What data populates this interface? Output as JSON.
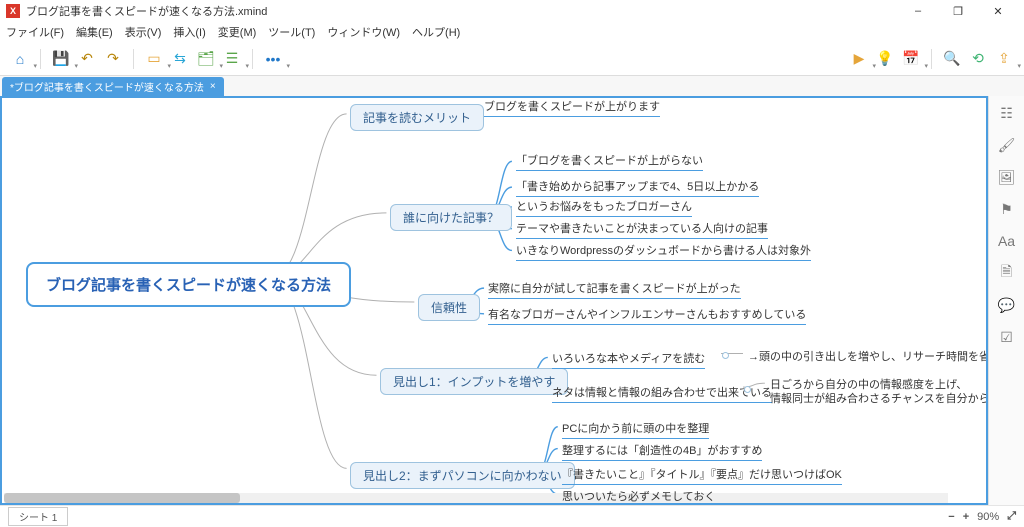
{
  "window": {
    "title": "ブログ記事を書くスピードが速くなる方法.xmind",
    "min_label": "–",
    "max_label": "❐",
    "close_label": "✕"
  },
  "menu": {
    "file": "ファイル(F)",
    "edit": "編集(E)",
    "view": "表示(V)",
    "insert": "挿入(I)",
    "modify": "変更(M)",
    "tool": "ツール(T)",
    "window": "ウィンドウ(W)",
    "help": "ヘルプ(H)"
  },
  "tab": {
    "label": "*ブログ記事を書くスピードが速くなる方法",
    "close": "×"
  },
  "map": {
    "root": "ブログ記事を書くスピードが速くなる方法",
    "m1": {
      "title": "記事を読むメリット",
      "l1": "ブログを書くスピードが上がります"
    },
    "m2": {
      "title": "誰に向けた記事？",
      "l1": "「ブログを書くスピードが上がらない",
      "l2": "「書き始めから記事アップまで4、5日以上かかる",
      "l3": "というお悩みをもったブロガーさん",
      "l4": "テーマや書きたいことが決まっている人向けの記事",
      "l5": "いきなりWordpressのダッシュボードから書ける人は対象外"
    },
    "m3": {
      "title": "信頼性",
      "l1": "実際に自分が試して記事を書くスピードが上がった",
      "l2": "有名なブロガーさんやインフルエンサーさんもおすすめしている"
    },
    "m4": {
      "title": "見出し1：インプットを増やす",
      "l1": "いろいろな本やメディアを読む",
      "l1b": "→頭の中の引き出しを増やし、リサーチ時間を省略・短縮する",
      "l2": "ネタは情報と情報の組み合わせで出来ている",
      "l2b1": "日ごろから自分の中の情報感度を上げ、",
      "l2b2": "情報同士が組み合わさるチャンスを自分から作る"
    },
    "m5": {
      "title": "見出し2：まずパソコンに向かわない",
      "l1": "PCに向かう前に頭の中を整理",
      "l2": "整理するには「創造性の4B」がおすすめ",
      "l3": "『書きたいこと』『タイトル』『要点』だけ思いつけばOK",
      "l4": "思いついたら必ずメモしておく"
    }
  },
  "status": {
    "sheet": "シート 1",
    "zoom": "90%",
    "minus": "−",
    "plus": "+",
    "fit": "⤢"
  }
}
